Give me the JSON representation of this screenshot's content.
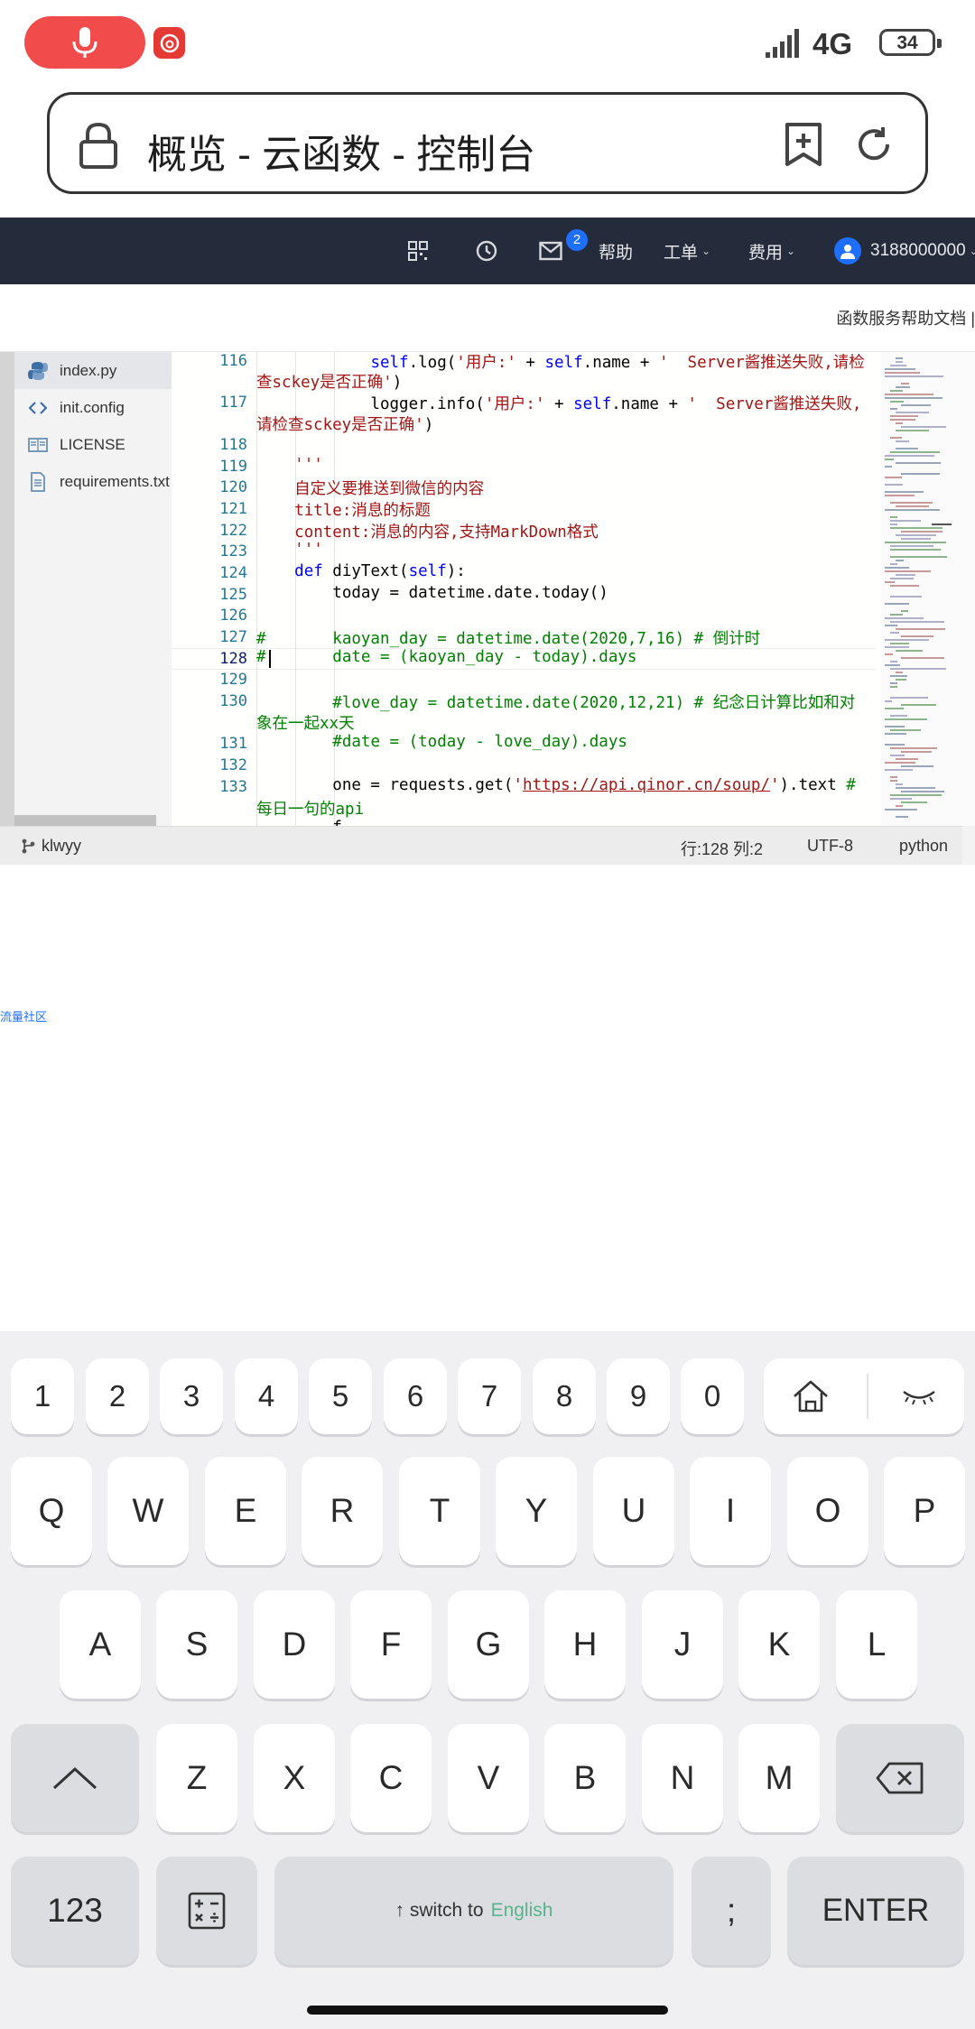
{
  "status_bar": {
    "network": "4G",
    "battery": "34",
    "icons": [
      "microphone-icon",
      "music-app-icon",
      "signal-icon",
      "battery-icon"
    ]
  },
  "url_bar": {
    "title": "概览 - 云函数 - 控制台"
  },
  "top_nav": {
    "mail_badge": "2",
    "help": "帮助",
    "ticket": "工单",
    "billing": "费用",
    "account": "3188000000"
  },
  "help_strip": {
    "doc_link": "函数服务帮助文档 |"
  },
  "file_tree": [
    {
      "name": "index.py",
      "icon": "python-icon",
      "active": true
    },
    {
      "name": "init.config",
      "icon": "code-icon",
      "active": false
    },
    {
      "name": "LICENSE",
      "icon": "book-icon",
      "active": false
    },
    {
      "name": "requirements.txt",
      "icon": "file-icon",
      "active": false
    }
  ],
  "editor": {
    "current_line": "128",
    "line_numbers": [
      "116",
      "117",
      "118",
      "119",
      "120",
      "121",
      "122",
      "123",
      "124",
      "125",
      "126",
      "127",
      "128",
      "129",
      "130",
      "131",
      "132",
      "133"
    ]
  },
  "editor_status": {
    "branch": "klwyy",
    "position": "行:128 列:2",
    "encoding": "UTF-8",
    "language": "python"
  },
  "community_link": "流量社区",
  "keyboard": {
    "number_row": [
      "1",
      "2",
      "3",
      "4",
      "5",
      "6",
      "7",
      "8",
      "9",
      "0"
    ],
    "row1": [
      "Q",
      "W",
      "E",
      "R",
      "T",
      "Y",
      "U",
      "I",
      "O",
      "P"
    ],
    "row2": [
      "A",
      "S",
      "D",
      "F",
      "G",
      "H",
      "J",
      "K",
      "L"
    ],
    "row3": [
      "Z",
      "X",
      "C",
      "V",
      "B",
      "N",
      "M"
    ],
    "mode_key": "123",
    "space_prefix": "↑ switch to",
    "space_lang": "English",
    "semicolon": ";",
    "enter": "ENTER"
  }
}
